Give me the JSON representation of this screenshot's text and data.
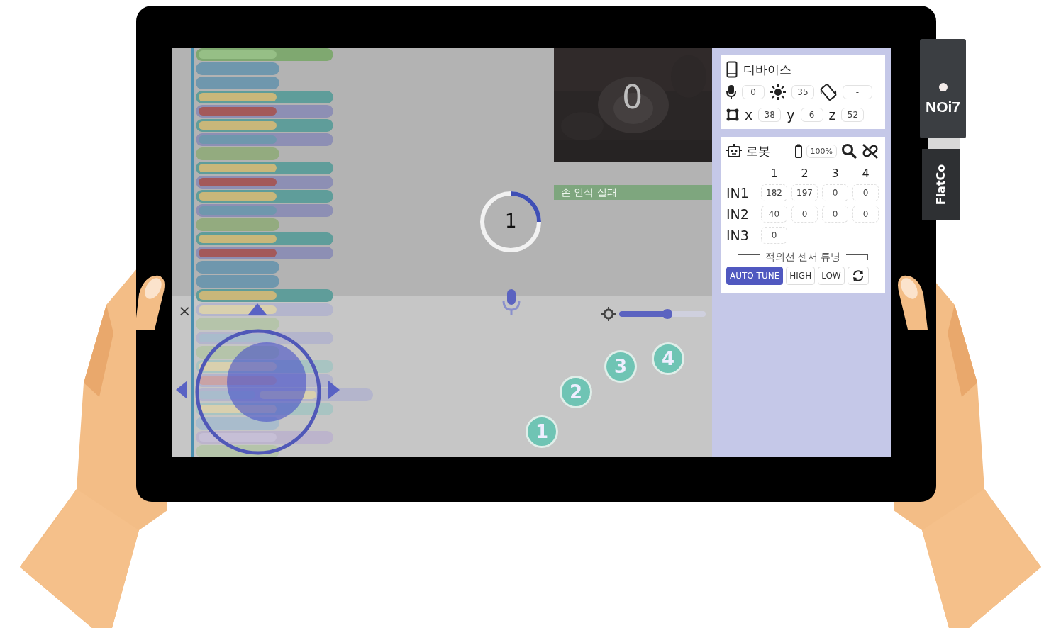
{
  "dongle": {
    "logo": "NOi7",
    "brand": "FlatCo"
  },
  "code_blocks": [
    {
      "color": "#7fa870",
      "segments": [
        {
          "color": "#96bf86"
        }
      ]
    },
    {
      "color": "#6f97ad"
    },
    {
      "color": "#6f97ad"
    },
    {
      "color": "#5f9d9a",
      "segments": [
        {
          "color": "#c9b77a"
        }
      ]
    },
    {
      "color": "#8d8fb4",
      "segments": [
        {
          "color": "#a3595a"
        }
      ]
    },
    {
      "color": "#5f9d9a",
      "segments": [
        {
          "color": "#c9b77a"
        }
      ]
    },
    {
      "color": "#8d8fb4",
      "segments": [
        {
          "color": "#6f97ad"
        }
      ]
    },
    {
      "color": "#93ab7f"
    },
    {
      "color": "#5f9d9a",
      "segments": [
        {
          "color": "#c9b77a"
        }
      ]
    },
    {
      "color": "#8d8fb4",
      "segments": [
        {
          "color": "#a3595a"
        }
      ]
    },
    {
      "color": "#5f9d9a",
      "segments": [
        {
          "color": "#c9b77a"
        }
      ]
    },
    {
      "color": "#8d8fb4",
      "segments": [
        {
          "color": "#6f97ad"
        }
      ]
    },
    {
      "color": "#93ab7f"
    },
    {
      "color": "#5f9d9a",
      "segments": [
        {
          "color": "#c9b77a"
        }
      ]
    },
    {
      "color": "#8d8fb4",
      "segments": [
        {
          "color": "#a3595a"
        }
      ]
    },
    {
      "color": "#6f97ad"
    },
    {
      "color": "#6f97ad"
    },
    {
      "color": "#5f9d9a",
      "segments": [
        {
          "color": "#c9b77a"
        }
      ]
    },
    {
      "color": "#b4b5cc",
      "segments": [
        {
          "color": "#d9d0ae"
        }
      ]
    },
    {
      "color": "#b5c4aa"
    },
    {
      "color": "#b4b5cc",
      "segments": [
        {
          "color": "#a9bccc"
        }
      ]
    },
    {
      "color": "#b5c4aa"
    },
    {
      "color": "#a8c4c2",
      "segments": [
        {
          "color": "#d9d0ae"
        }
      ]
    },
    {
      "color": "#b4b5cc",
      "segments": [
        {
          "color": "#c9a3a6"
        }
      ]
    },
    {
      "color": "#b4b5cc",
      "segments": [
        {
          "color": "#a9bccc"
        },
        {
          "color": "#d9d0ae"
        }
      ]
    },
    {
      "color": "#a8c4c2",
      "segments": [
        {
          "color": "#d9d0ae"
        }
      ]
    },
    {
      "color": "#a9bccc"
    },
    {
      "color": "#bcb4cc",
      "segments": [
        {
          "color": "#c6bfd6"
        }
      ]
    },
    {
      "color": "#b5c4aa"
    }
  ],
  "camera": {
    "count": "0"
  },
  "status": "손 인식 실패",
  "countdown": {
    "value": "1",
    "level": 0.25
  },
  "close": "×",
  "brightness": {
    "level": 0.56
  },
  "number_buttons": [
    "1",
    "2",
    "3",
    "4"
  ],
  "device": {
    "title": "디바이스",
    "mic": "0",
    "light": "35",
    "rotation": "-",
    "axes": [
      {
        "label": "x",
        "value": "38"
      },
      {
        "label": "y",
        "value": "6"
      },
      {
        "label": "z",
        "value": "52"
      }
    ]
  },
  "robot": {
    "title": "로봇",
    "battery": "100%",
    "columns": [
      "1",
      "2",
      "3",
      "4"
    ],
    "rows": [
      {
        "label": "IN1",
        "values": [
          "182",
          "197",
          "0",
          "0"
        ]
      },
      {
        "label": "IN2",
        "values": [
          "40",
          "0",
          "0",
          "0"
        ]
      },
      {
        "label": "IN3",
        "values": [
          "0"
        ]
      }
    ],
    "tuning_label": "적외선 센서 튜닝",
    "buttons": [
      {
        "kind": "text",
        "label": "AUTO TUNE",
        "selected": true
      },
      {
        "kind": "text",
        "label": "HIGH",
        "selected": false
      },
      {
        "kind": "text",
        "label": "LOW",
        "selected": false
      },
      {
        "kind": "refresh",
        "selected": false
      }
    ]
  }
}
